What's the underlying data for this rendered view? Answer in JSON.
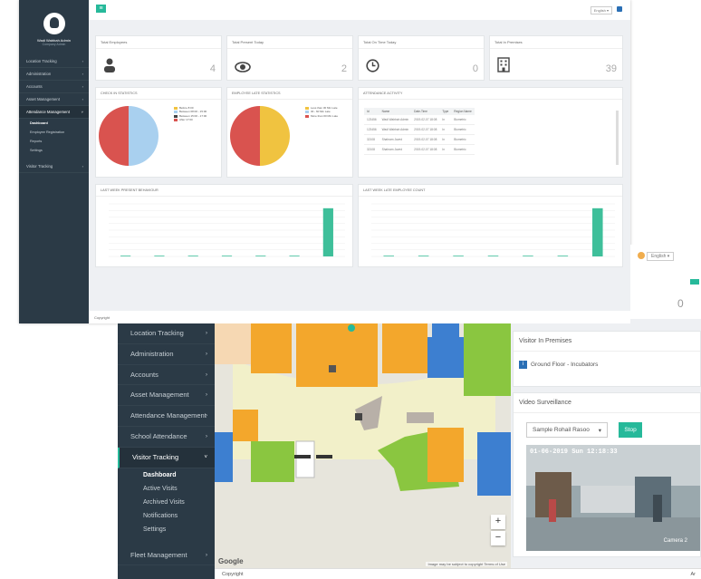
{
  "screen1": {
    "user_name": "Wadi Wabbah Admin",
    "user_role": "Company Admin",
    "sidebar": [
      {
        "label": "Location Tracking"
      },
      {
        "label": "Administration"
      },
      {
        "label": "Accounts"
      },
      {
        "label": "Asset Management"
      },
      {
        "label": "Attendance Management"
      }
    ],
    "sidebar_sub": [
      "Dashboard",
      "Employee Registration",
      "Reports",
      "Settings"
    ],
    "sidebar_after": "Visitor Tracking",
    "language": "English",
    "stats": [
      {
        "label": "Total Employees",
        "value": "4",
        "icon": "person-icon"
      },
      {
        "label": "Total Present Today",
        "value": "2",
        "icon": "eye-icon"
      },
      {
        "label": "Total On Time Today",
        "value": "0",
        "icon": "clock-icon"
      },
      {
        "label": "Total In Premises",
        "value": "39",
        "icon": "building-icon"
      }
    ],
    "checkin_title": "CHECK IN STATISTICS",
    "checkin_legend": [
      "Before 8:00",
      "Between 08:00 - 15:00",
      "Between 15:00 - 17:00",
      "After 17:00"
    ],
    "late_title": "EMPLOYEE LATE STATISTICS",
    "late_legend": [
      "Less than 30 Min Late",
      "30 - 60 Min Late",
      "More than 60 Min Late"
    ],
    "attendance_title": "ATTENDANCE ACTIVITY",
    "attendance_headers": [
      "Id",
      "Name",
      "Date-Time",
      "Type",
      "Region Name"
    ],
    "attendance_rows": [
      [
        "123456",
        "Wadi Wabbah Admin",
        "2019-02-07 18:08",
        "In",
        "Biometric"
      ],
      [
        "123456",
        "Wadi Wabbah Admin",
        "2019-02-07 18:08",
        "In",
        "Biometric"
      ],
      [
        "32108",
        "Shahram Javed",
        "2019-02-07 18:08",
        "In",
        "Biometric"
      ],
      [
        "32108",
        "Shahram Javed",
        "2019-02-07 18:08",
        "In",
        "Biometric"
      ]
    ],
    "present_title": "LAST WEEK PRESENT BEHAVIOUR",
    "late_count_title": "LAST WEEK LATE EMPLOYEE COUNT",
    "copyright": "Copyright"
  },
  "screen2": {
    "sidebar": [
      {
        "label": "Location Tracking"
      },
      {
        "label": "Administration"
      },
      {
        "label": "Accounts"
      },
      {
        "label": "Asset Management"
      },
      {
        "label": "Attendance Management"
      },
      {
        "label": "School Attendance"
      },
      {
        "label": "Visitor Tracking"
      }
    ],
    "sidebar_sub": [
      "Dashboard",
      "Active Visits",
      "Archived Visits",
      "Notifications",
      "Settings"
    ],
    "sidebar_after": "Fleet Management",
    "visitor_title": "Visitor In Premises",
    "visitor_item": "Ground Floor - Incubators",
    "video_title": "Video Surveillance",
    "camera_select": "Sample Rohail Rasoo",
    "stop_label": "Stop",
    "video_timestamp": "01-06-2019 Sun 12:18:33",
    "camera_label": "Camera 2",
    "map_brand": "Google",
    "map_attribution": "Image may be subject to copyright   Terms of Use",
    "zoom_in": "+",
    "zoom_out": "−",
    "copyright": "Copyright",
    "footer_right": "Ar"
  },
  "screen3": {
    "language": "English",
    "notif_count": "0",
    "value": "0"
  },
  "chart_data": [
    {
      "type": "pie",
      "title": "CHECK IN STATISTICS",
      "series": [
        {
          "values": [
            50,
            50
          ]
        }
      ],
      "colors": [
        "#d9534f",
        "#a9d0ef"
      ]
    },
    {
      "type": "pie",
      "title": "EMPLOYEE LATE STATISTICS",
      "series": [
        {
          "values": [
            50,
            50
          ]
        }
      ],
      "colors": [
        "#d9534f",
        "#f0c340"
      ]
    },
    {
      "type": "bar",
      "title": "LAST WEEK PRESENT BEHAVIOUR",
      "categories": [
        "",
        "",
        "",
        "",
        "",
        "",
        "2"
      ],
      "values": [
        0,
        0,
        0,
        0,
        0,
        0,
        2.2
      ],
      "ylim": [
        0,
        2.4
      ],
      "color": "#3ebf9a"
    },
    {
      "type": "bar",
      "title": "LAST WEEK LATE EMPLOYEE COUNT",
      "categories": [
        "",
        "",
        "",
        "",
        "",
        "",
        "2"
      ],
      "values": [
        0,
        0,
        0,
        0,
        0,
        0,
        2.2
      ],
      "ylim": [
        0,
        2.4
      ],
      "color": "#3ebf9a"
    }
  ]
}
